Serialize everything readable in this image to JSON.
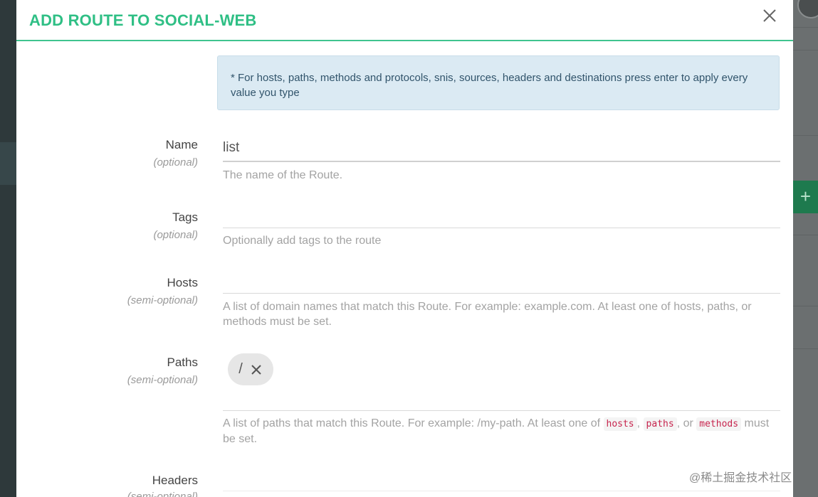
{
  "modal": {
    "title": "ADD ROUTE TO SOCIAL-WEB",
    "close_icon": "close-icon",
    "info": "* For hosts, paths, methods and protocols, snis, sources, headers and destinations press enter to apply every value you type"
  },
  "fields": {
    "name": {
      "label": "Name",
      "hint": "(optional)",
      "value": "list",
      "help": "The name of the Route."
    },
    "tags": {
      "label": "Tags",
      "hint": "(optional)",
      "value": "",
      "help": "Optionally add tags to the route"
    },
    "hosts": {
      "label": "Hosts",
      "hint": "(semi-optional)",
      "value": "",
      "help": "A list of domain names that match this Route. For example: example.com. At least one of hosts, paths, or methods must be set."
    },
    "paths": {
      "label": "Paths",
      "hint": "(semi-optional)",
      "chip": "/",
      "help_prefix": "A list of paths that match this Route. For example: /my-path. At least one of",
      "code_hosts": "hosts",
      "sep1": ",",
      "code_paths": "paths",
      "sep2": ", or",
      "code_methods": "methods",
      "help_suffix": "must be set."
    },
    "headers": {
      "label": "Headers",
      "hint": "(semi-optional)"
    }
  },
  "background": {
    "plus_label": "+"
  },
  "watermark": "@稀土掘金技术社区",
  "colors": {
    "accent": "#2fbf85",
    "info_bg": "#dbeaf3",
    "code_red": "#c7254e"
  }
}
